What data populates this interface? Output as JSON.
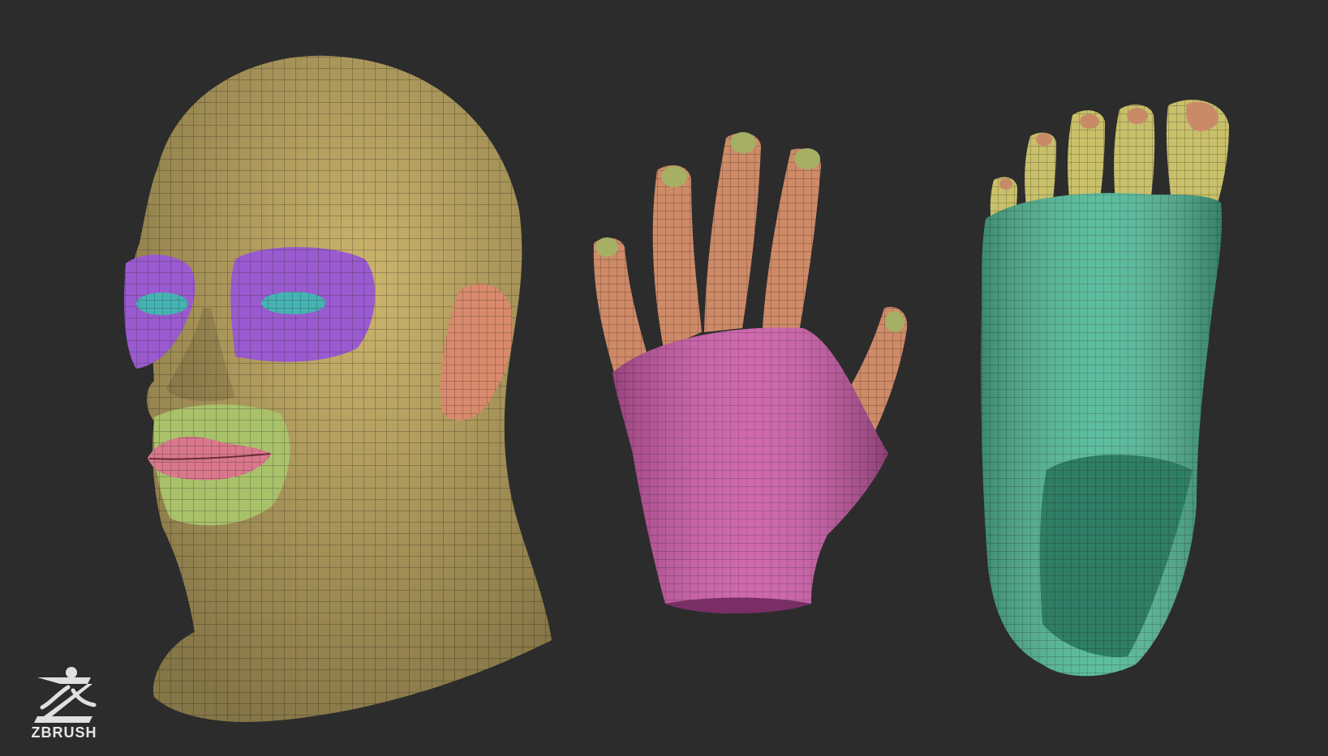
{
  "colors": {
    "background": "#2c2c2c",
    "skin_polygroup": "#cdb56d",
    "eye_socket_polygroup": "#9a5ad0",
    "eyeball_polygroup": "#45b3b3",
    "mouth_polygroup": "#a9c26a",
    "lips_polygroup": "#d9788c",
    "ear_polygroup": "#d98a6c",
    "finger_polygroup": "#cf8a68",
    "palm_polygroup": "#cc5aa8",
    "nail_polygroup": "#a5b064",
    "foot_polygroup": "#4fb897",
    "toe_polygroup": "#c9c06a",
    "toenail_polygroup": "#c98a68",
    "wireframe": "#2a2a1e"
  },
  "icons": {
    "brand_logo": "zbrush-figure-icon"
  },
  "logo": {
    "text": "ZBRUSH"
  }
}
